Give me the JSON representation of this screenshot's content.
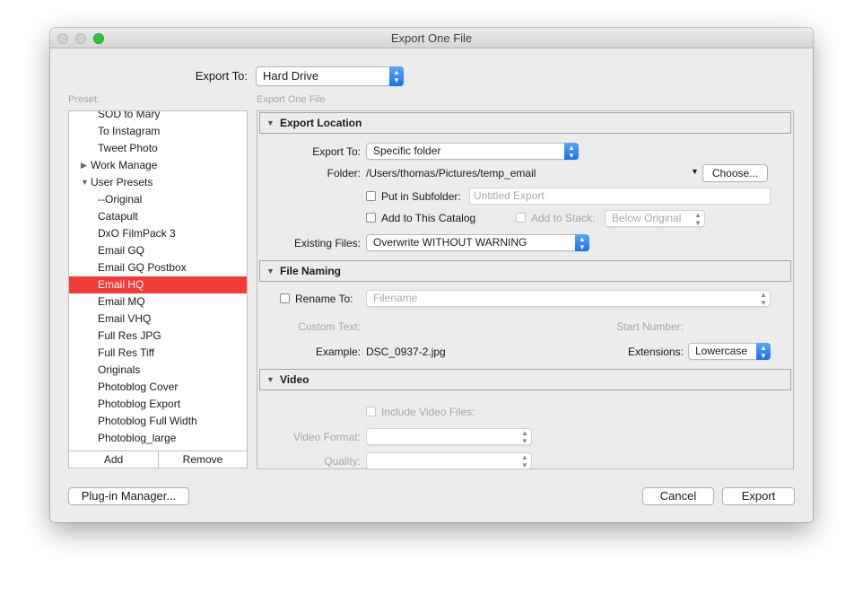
{
  "window": {
    "title": "Export One File"
  },
  "header": {
    "export_to_label": "Export To:",
    "export_to_value": "Hard Drive"
  },
  "preset_panel": {
    "label": "Preset:",
    "items": [
      {
        "label": "SOD to Mary",
        "kind": "item"
      },
      {
        "label": "To Instagram",
        "kind": "item"
      },
      {
        "label": "Tweet Photo",
        "kind": "item"
      },
      {
        "label": "Work Manage",
        "kind": "folder-collapsed"
      },
      {
        "label": "User Presets",
        "kind": "folder-expanded"
      },
      {
        "label": "--Original",
        "kind": "item"
      },
      {
        "label": "Catapult",
        "kind": "item"
      },
      {
        "label": "DxO FilmPack 3",
        "kind": "item"
      },
      {
        "label": "Email GQ",
        "kind": "item"
      },
      {
        "label": "Email GQ Postbox",
        "kind": "item"
      },
      {
        "label": "Email HQ",
        "kind": "item",
        "selected": true
      },
      {
        "label": "Email MQ",
        "kind": "item"
      },
      {
        "label": "Email VHQ",
        "kind": "item"
      },
      {
        "label": "Full Res JPG",
        "kind": "item"
      },
      {
        "label": "Full Res Tiff",
        "kind": "item"
      },
      {
        "label": "Originals",
        "kind": "item"
      },
      {
        "label": "Photoblog Cover",
        "kind": "item"
      },
      {
        "label": "Photoblog Export",
        "kind": "item"
      },
      {
        "label": "Photoblog Full Width",
        "kind": "item"
      },
      {
        "label": "Photoblog_large",
        "kind": "item"
      }
    ],
    "add_label": "Add",
    "remove_label": "Remove"
  },
  "main": {
    "caption": "Export One File",
    "export_location": {
      "title": "Export Location",
      "export_to_label": "Export To:",
      "export_to_value": "Specific folder",
      "folder_label": "Folder:",
      "folder_path": "/Users/thomas/Pictures/temp_email",
      "choose_label": "Choose...",
      "subfolder_label": "Put in Subfolder:",
      "subfolder_placeholder": "Untitled Export",
      "catalog_label": "Add to This Catalog",
      "stack_label": "Add to Stack:",
      "stack_value": "Below Original",
      "existing_label": "Existing Files:",
      "existing_value": "Overwrite WITHOUT WARNING"
    },
    "file_naming": {
      "title": "File Naming",
      "rename_label": "Rename To:",
      "rename_value": "Filename",
      "custom_text_label": "Custom Text:",
      "start_number_label": "Start Number:",
      "example_label": "Example:",
      "example_value": "DSC_0937-2.jpg",
      "extensions_label": "Extensions:",
      "extensions_value": "Lowercase"
    },
    "video": {
      "title": "Video",
      "include_label": "Include Video Files:",
      "format_label": "Video Format:",
      "quality_label": "Quality:"
    }
  },
  "footer": {
    "plugin_manager_label": "Plug-in Manager...",
    "cancel_label": "Cancel",
    "export_label": "Export"
  },
  "colors": {
    "selection": "#f23b3b",
    "accent_popup": "#1a70f0",
    "zoom_button": "#2fc23f"
  }
}
